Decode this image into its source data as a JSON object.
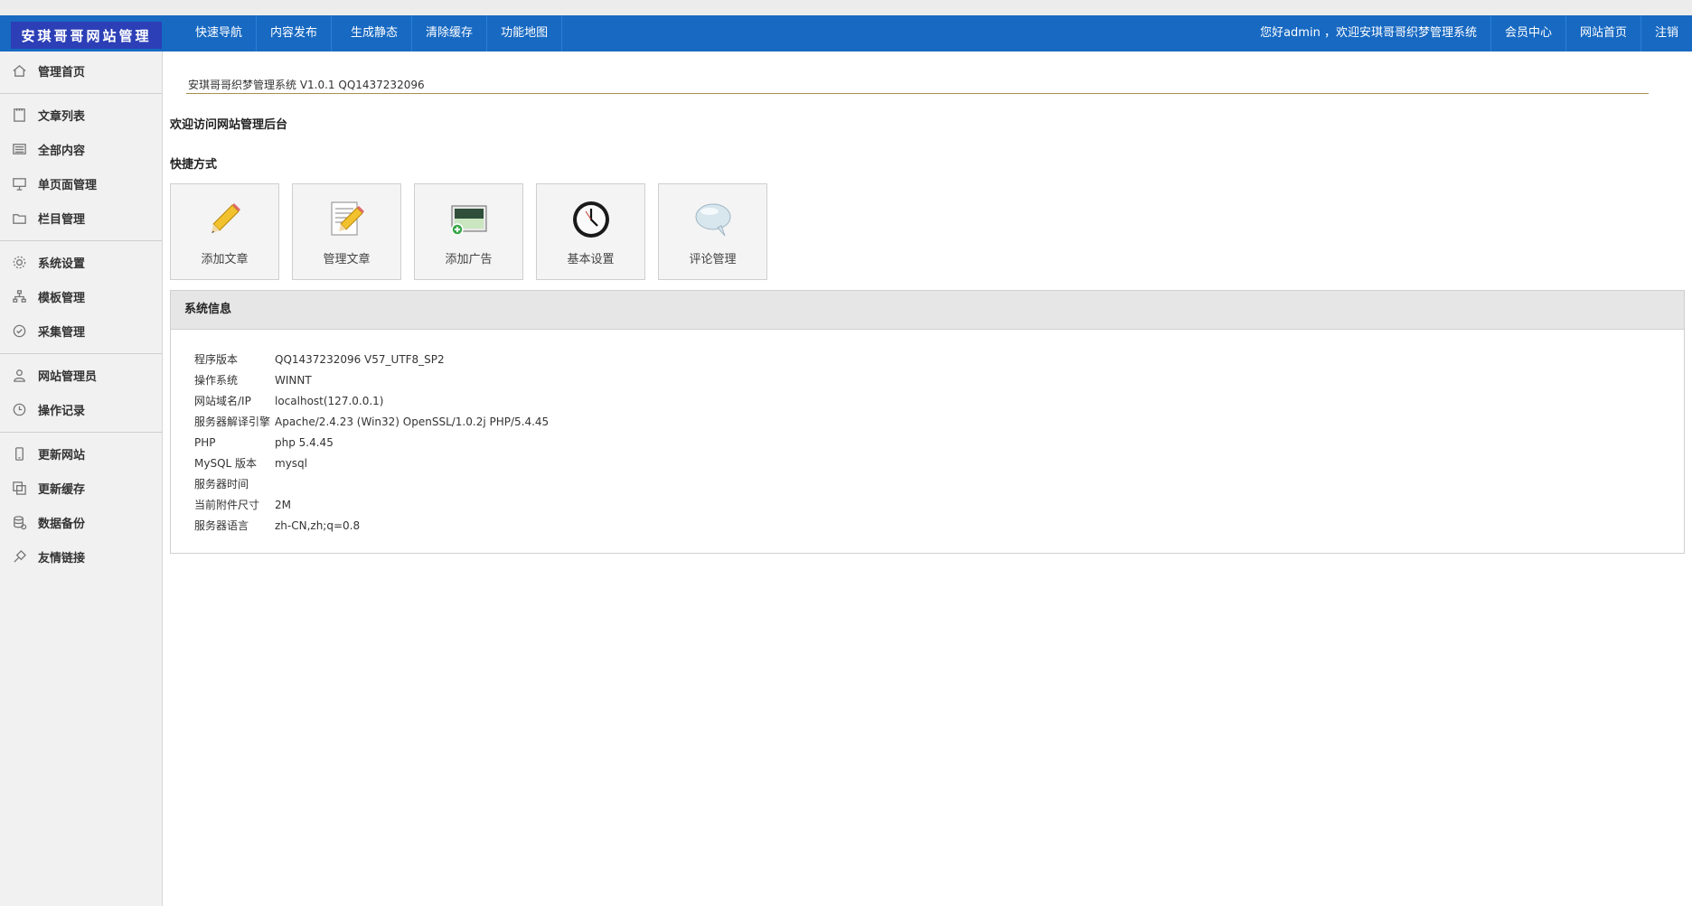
{
  "header": {
    "logo": "安琪哥哥网站管理",
    "nav": [
      "快速导航",
      "内容发布",
      "生成静态",
      "清除缓存",
      "功能地图"
    ],
    "welcome": "您好admin ，欢迎安琪哥哥织梦管理系统",
    "right_links": [
      "会员中心",
      "网站首页",
      "注销"
    ]
  },
  "sidebar": {
    "groups": [
      [
        {
          "label": "管理首页",
          "icon": "home-icon"
        }
      ],
      [
        {
          "label": "文章列表",
          "icon": "notebook-icon"
        },
        {
          "label": "全部内容",
          "icon": "list-icon"
        },
        {
          "label": "单页面管理",
          "icon": "presentation-icon"
        },
        {
          "label": "栏目管理",
          "icon": "folder-icon"
        }
      ],
      [
        {
          "label": "系统设置",
          "icon": "gear-icon"
        },
        {
          "label": "模板管理",
          "icon": "sitemap-icon"
        },
        {
          "label": "采集管理",
          "icon": "collect-icon"
        }
      ],
      [
        {
          "label": "网站管理员",
          "icon": "user-icon"
        },
        {
          "label": "操作记录",
          "icon": "clock-icon"
        }
      ],
      [
        {
          "label": "更新网站",
          "icon": "mobile-icon"
        },
        {
          "label": "更新缓存",
          "icon": "copy-icon"
        },
        {
          "label": "数据备份",
          "icon": "database-icon"
        },
        {
          "label": "友情链接",
          "icon": "link-icon"
        }
      ]
    ]
  },
  "main": {
    "version": "安琪哥哥织梦管理系统 V1.0.1 QQ1437232096",
    "welcome_title": "欢迎访问网站管理后台",
    "quick_title": "快捷方式",
    "shortcuts": [
      {
        "label": "添加文章",
        "icon": "pencil-icon"
      },
      {
        "label": "管理文章",
        "icon": "edit-document-icon"
      },
      {
        "label": "添加广告",
        "icon": "add-image-icon"
      },
      {
        "label": "基本设置",
        "icon": "clock-icon"
      },
      {
        "label": "评论管理",
        "icon": "speech-bubble-icon"
      }
    ],
    "sysinfo_title": "系统信息",
    "sysinfo": [
      {
        "key": "程序版本",
        "value": "QQ1437232096 V57_UTF8_SP2"
      },
      {
        "key": "操作系统",
        "value": "WINNT"
      },
      {
        "key": "网站域名/IP",
        "value": "localhost(127.0.0.1)"
      },
      {
        "key": "服务器解译引擎",
        "value": "Apache/2.4.23 (Win32) OpenSSL/1.0.2j PHP/5.4.45"
      },
      {
        "key": "PHP",
        "value": "php 5.4.45"
      },
      {
        "key": "MySQL 版本",
        "value": "mysql"
      },
      {
        "key": "服务器时间",
        "value": ""
      },
      {
        "key": "当前附件尺寸",
        "value": "2M"
      },
      {
        "key": "服务器语言",
        "value": "zh-CN,zh;q=0.8"
      }
    ]
  },
  "colors": {
    "header_blue": "#1769c2",
    "logo_blue": "#2c3fb7",
    "sidebar_bg": "#f1f1f1"
  }
}
